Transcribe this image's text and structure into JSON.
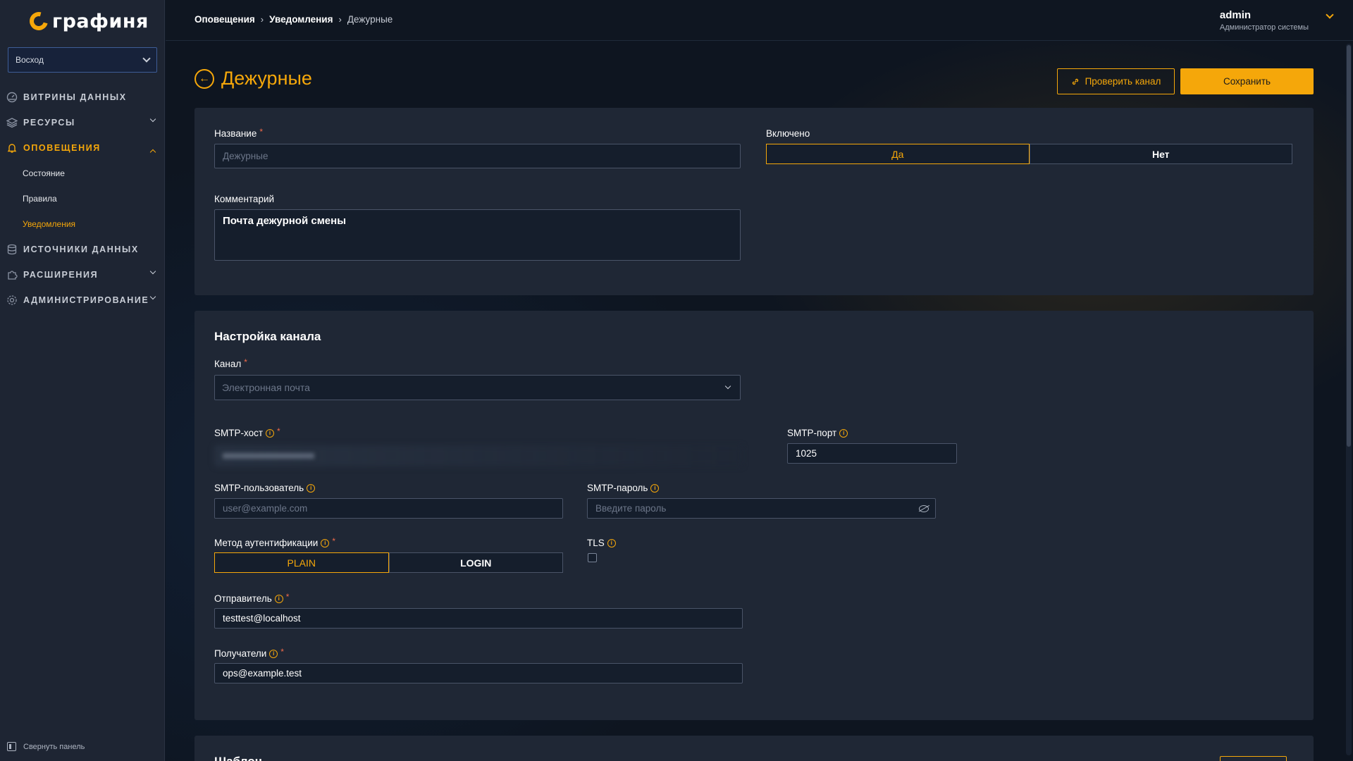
{
  "app": {
    "logo_text": "графиня"
  },
  "sidebar": {
    "org": "Восход",
    "items": [
      {
        "label": "ВИТРИНЫ ДАННЫХ",
        "icon": "dashboard-icon"
      },
      {
        "label": "РЕСУРСЫ",
        "icon": "layers-icon"
      },
      {
        "label": "ОПОВЕЩЕНИЯ",
        "icon": "bell-icon"
      },
      {
        "label": "ИСТОЧНИКИ ДАННЫХ",
        "icon": "database-icon"
      },
      {
        "label": "РАСШИРЕНИЯ",
        "icon": "puzzle-icon"
      },
      {
        "label": "АДМИНИСТРИРОВАНИЕ",
        "icon": "gear-icon"
      }
    ],
    "subitems": [
      "Состояние",
      "Правила",
      "Уведомления"
    ],
    "collapse_label": "Свернуть панель"
  },
  "header": {
    "breadcrumb": [
      "Оповещения",
      "Уведомления",
      "Дежурные"
    ],
    "user_name": "admin",
    "user_role": "Администратор системы"
  },
  "page": {
    "title": "Дежурные",
    "check_button": "Проверить канал",
    "save_button": "Сохранить"
  },
  "general": {
    "name_label": "Название",
    "name_placeholder": "Дежурные",
    "enabled_label": "Включено",
    "enabled_yes": "Да",
    "enabled_no": "Нет",
    "comment_label": "Комментарий",
    "comment_value": "Почта дежурной смены"
  },
  "channel": {
    "section_title": "Настройка канала",
    "channel_label": "Канал",
    "channel_placeholder": "Электронная почта",
    "smtp_host_label": "SMTP-хост",
    "smtp_port_label": "SMTP-порт",
    "smtp_port_value": "1025",
    "smtp_user_label": "SMTP-пользователь",
    "smtp_user_placeholder": "user@example.com",
    "smtp_pass_label": "SMTP-пароль",
    "smtp_pass_placeholder": "Введите пароль",
    "auth_label": "Метод аутентификации",
    "auth_plain": "PLAIN",
    "auth_login": "LOGIN",
    "tls_label": "TLS",
    "sender_label": "Отправитель",
    "sender_value": "testtest@localhost",
    "recipients_label": "Получатели",
    "recipients_value": "ops@example.test"
  },
  "template": {
    "section_title": "Шаблон"
  },
  "colors": {
    "accent": "#f5a70a",
    "card": "#1f2735",
    "sidebar": "#1e2533",
    "background": "#0e1520",
    "required": "#f06a4a"
  }
}
